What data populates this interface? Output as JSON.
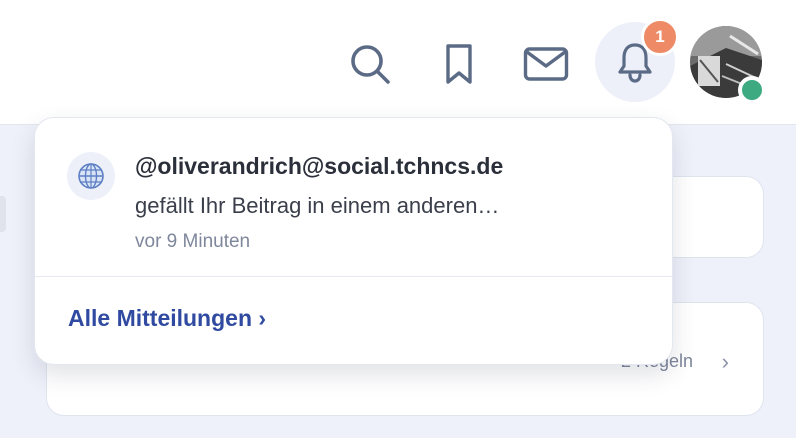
{
  "header": {
    "icons": {
      "search": "search-icon",
      "bookmark": "bookmark-icon",
      "mail": "mail-icon",
      "bell": "bell-icon"
    },
    "notification_count": "1",
    "user_status": "online"
  },
  "notifications_popover": {
    "items": [
      {
        "icon": "globe-icon",
        "title": "@oliverandrich@social.tchncs.de",
        "body": "gefällt Ihr Beitrag in einem anderen…",
        "time": "vor 9 Minuten"
      }
    ],
    "all_link": "Alle Mitteilungen ›"
  },
  "background": {
    "card_count": "2 Regeln",
    "card_chevron": "›"
  },
  "colors": {
    "badge": "#ee8a66",
    "status_online": "#3daa82",
    "link": "#2f4aa0",
    "page_bg": "#eef1f9"
  }
}
